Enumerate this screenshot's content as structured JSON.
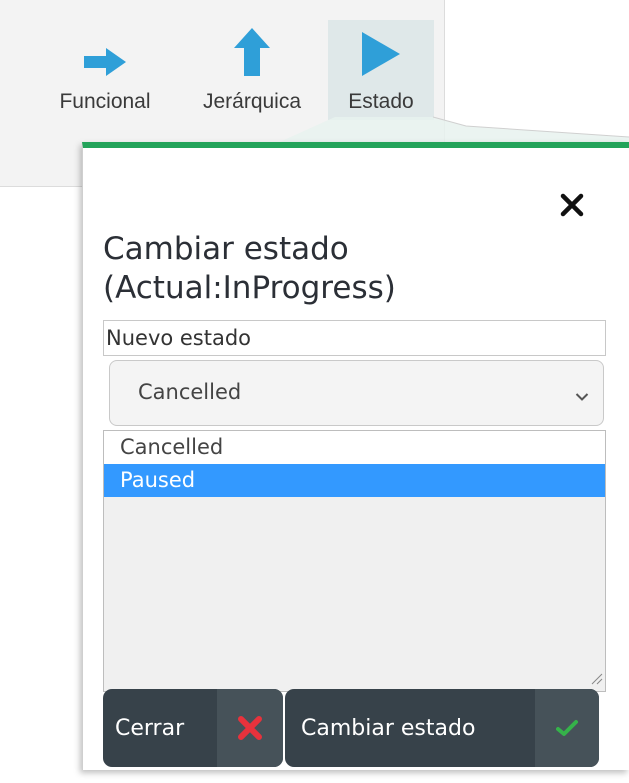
{
  "toolbar": {
    "buttons": [
      {
        "label": "Funcional",
        "icon": "arrow-right-icon",
        "color": "#2f9fd8"
      },
      {
        "label": "Jerárquica",
        "icon": "arrow-up-icon",
        "color": "#2f9fd8"
      },
      {
        "label": "Estado",
        "icon": "play-icon",
        "color": "#2f9fd8",
        "active": true
      }
    ]
  },
  "dialog": {
    "title": "Cambiar estado (Actual:InProgress)",
    "field_label": "Nuevo estado",
    "select": {
      "value": "Cancelled"
    },
    "options": [
      {
        "label": "Cancelled",
        "selected": false
      },
      {
        "label": "Paused",
        "selected": true
      }
    ],
    "close_button": {
      "label": "Cerrar",
      "icon": "close-icon",
      "icon_color": "#e8323c"
    },
    "submit_button": {
      "label": "Cambiar estado",
      "icon": "check-icon",
      "icon_color": "#35b24a"
    }
  },
  "colors": {
    "accent_border": "#23a35a",
    "button_bg": "#37424a",
    "selection": "#3399ff"
  }
}
